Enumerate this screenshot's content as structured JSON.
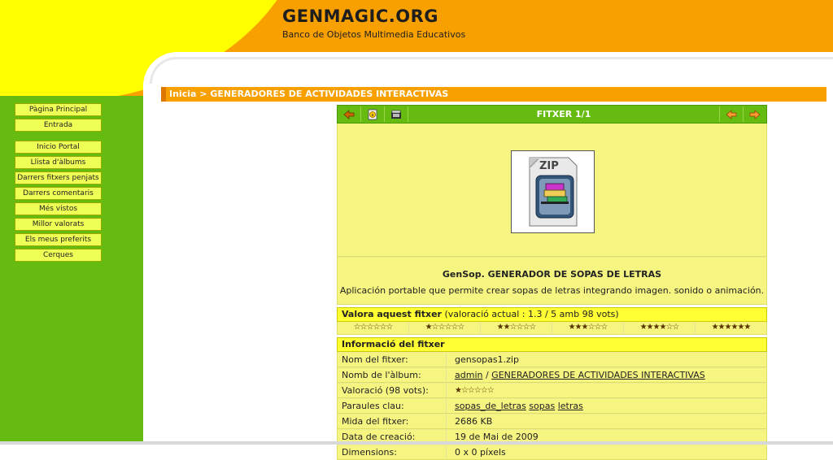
{
  "header": {
    "site_title": "GENMAGIC.ORG",
    "site_subtitle": "Banco de Objetos Multimedia Educativos"
  },
  "sidebar": {
    "group1": [
      {
        "label": "Pàgina Principal"
      },
      {
        "label": "Entrada"
      }
    ],
    "group2": [
      {
        "label": "Inicio Portal"
      },
      {
        "label": "Llista d'àlbums"
      },
      {
        "label": "Darrers fitxers penjats"
      },
      {
        "label": "Darrers comentaris"
      },
      {
        "label": "Més vistos"
      },
      {
        "label": "Millor valorats"
      },
      {
        "label": "Els meus preferits"
      },
      {
        "label": "Cerques"
      }
    ]
  },
  "breadcrumb": {
    "home": "Inicia",
    "separator": " > ",
    "current": "GENERADORES DE ACTIVIDADES INTERACTIVAS"
  },
  "file_nav": {
    "title": "FITXER 1/1",
    "icons": [
      "back-icon",
      "info-icon",
      "slideshow-icon",
      "prev-icon",
      "next-icon"
    ]
  },
  "thumbnail": {
    "label": "ZIP",
    "icon": "zip-file-icon"
  },
  "caption": {
    "title": "GenSop. GENERADOR DE SOPAS DE LETRAS",
    "description": "Aplicación portable que permite crear sopas de letras integrando imagen. sonido o animación."
  },
  "rating": {
    "heading": "Valora aquest fitxer",
    "current": "(valoració actual : 1.3 / 5 amb 98 vots)",
    "options": [
      "☆☆☆☆☆☆",
      "★☆☆☆☆☆",
      "★★☆☆☆☆",
      "★★★☆☆☆",
      "★★★★☆☆",
      "★★★★★★"
    ]
  },
  "info": {
    "heading": "Informació del fitxer",
    "rows": {
      "filename_label": "Nom del fitxer:",
      "filename_value": "gensopas1.zip",
      "album_label": "Nomb de l'àlbum:",
      "album_owner": "admin",
      "album_sep": " / ",
      "album_name": "GENERADORES DE ACTIVIDADES INTERACTIVAS",
      "rating_label": "Valoració (98 vots):",
      "rating_value": "★☆☆☆☆☆",
      "keywords_label": "Paraules clau:",
      "keyword1": "sopas_de_letras",
      "keyword2": "sopas",
      "keyword3": "letras",
      "size_label": "Mida del fitxer:",
      "size_value": "2686 KB",
      "date_label": "Data de creació:",
      "date_value": "19 de Mai de 2009",
      "dims_label": "Dimensions:",
      "dims_value": "0 x 0 píxels"
    }
  },
  "colors": {
    "orange": "#f8a000",
    "yellow": "#ffff00",
    "green": "#66bb11",
    "panel": "#f7f581"
  }
}
